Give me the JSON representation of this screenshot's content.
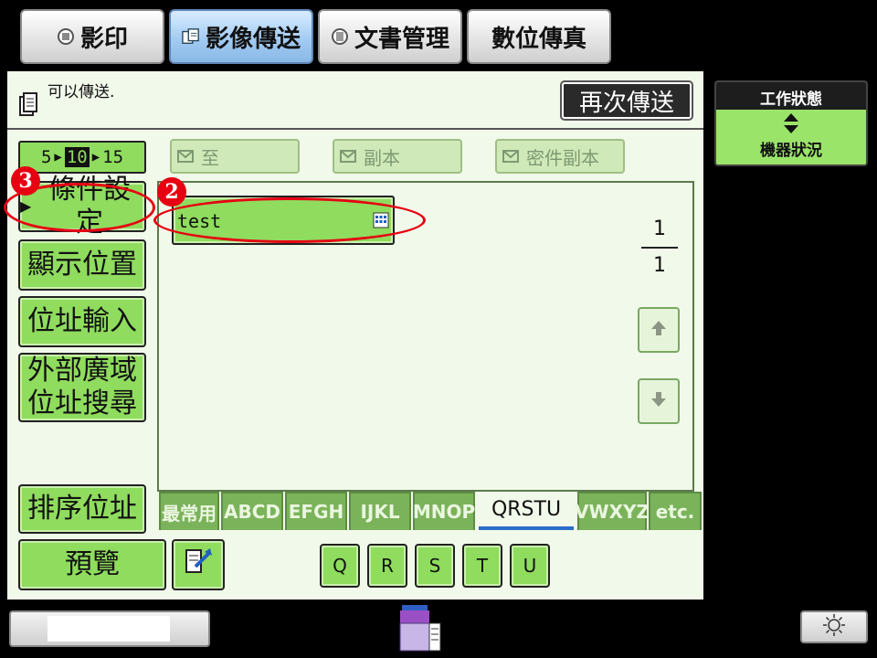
{
  "tabs": [
    {
      "label": "影印",
      "icon": "copy-icon"
    },
    {
      "label": "影像傳送",
      "icon": "image-send-icon"
    },
    {
      "label": "文書管理",
      "icon": "document-filing-icon"
    },
    {
      "label": "數位傳真",
      "icon": ""
    }
  ],
  "message": "可以傳送.",
  "resend_label": "再次傳送",
  "status": {
    "job_status": "工作狀態",
    "arrow": "▲\n▼",
    "machine_status": "機器狀況"
  },
  "sidebar": {
    "pager": {
      "a": "5",
      "b": "10",
      "c": "15"
    },
    "buttons": [
      "條件設定",
      "顯示位置",
      "位址輸入",
      "外部廣域位址搜尋"
    ],
    "sort_label": "排序位址",
    "preview_label": "預覽"
  },
  "destinations": {
    "to": "至",
    "cc": "副本",
    "bcc": "密件副本"
  },
  "address_entry": "test",
  "page_indicator": {
    "current": "1",
    "total": "1"
  },
  "index_tabs": [
    "最常用",
    "ABCD",
    "EFGH",
    "IJKL",
    "MNOP",
    "QRSTU",
    "VWXYZ",
    "etc."
  ],
  "index_selected": "QRSTU",
  "letter_keys": [
    "Q",
    "R",
    "S",
    "T",
    "U"
  ],
  "callouts": {
    "first": "3",
    "second": "2"
  },
  "colors": {
    "panel_green": "#8fdc5e",
    "panel_bg": "#f1f9ea",
    "highlight": "#e60012",
    "active_tab": "#9fc9f2"
  }
}
